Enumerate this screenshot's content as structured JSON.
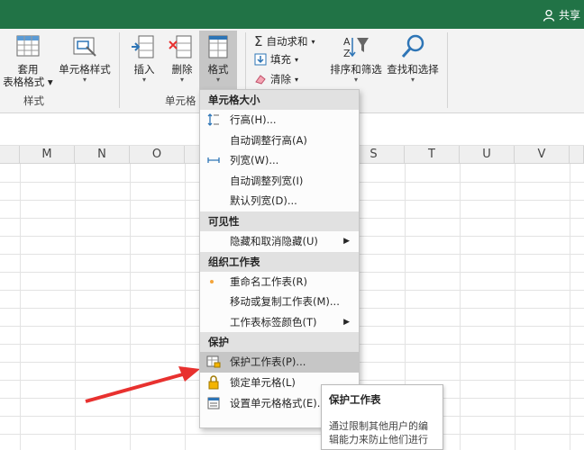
{
  "titlebar": {
    "share_label": "共享"
  },
  "ribbon": {
    "styles_group": {
      "label": "样式",
      "table_format_top": "套用",
      "table_format_bottom": "表格格式",
      "cell_styles": "单元格样式"
    },
    "cells_group": {
      "label": "单元格",
      "insert": "插入",
      "delete": "删除",
      "format": "格式"
    },
    "editing_group": {
      "autosum": "自动求和",
      "fill": "填充",
      "clear": "清除",
      "sort_filter": "排序和筛选",
      "find_select": "查找和选择"
    }
  },
  "columns": [
    "M",
    "N",
    "O",
    "S",
    "T",
    "U",
    "V"
  ],
  "menu": {
    "sections": [
      {
        "title": "单元格大小",
        "items": [
          {
            "label": "行高(H)...",
            "icon": "row-height-icon"
          },
          {
            "label": "自动调整行高(A)",
            "icon": ""
          },
          {
            "label": "列宽(W)...",
            "icon": "column-width-icon"
          },
          {
            "label": "自动调整列宽(I)",
            "icon": ""
          },
          {
            "label": "默认列宽(D)...",
            "icon": ""
          }
        ]
      },
      {
        "title": "可见性",
        "items": [
          {
            "label": "隐藏和取消隐藏(U)",
            "icon": "",
            "submenu": true
          }
        ]
      },
      {
        "title": "组织工作表",
        "items": [
          {
            "label": "重命名工作表(R)",
            "icon": "dot-icon"
          },
          {
            "label": "移动或复制工作表(M)...",
            "icon": ""
          },
          {
            "label": "工作表标签颜色(T)",
            "icon": "",
            "submenu": true
          }
        ]
      },
      {
        "title": "保护",
        "items": [
          {
            "label": "保护工作表(P)...",
            "icon": "protect-sheet-icon",
            "highlighted": true
          },
          {
            "label": "锁定单元格(L)",
            "icon": "lock-icon"
          },
          {
            "label": "设置单元格格式(E)...",
            "icon": "format-cells-icon"
          }
        ]
      }
    ]
  },
  "tooltip": {
    "title": "保护工作表",
    "desc": "通过限制其他用户的编辑能力来防止他们进行"
  },
  "colors": {
    "titlebar": "#217346",
    "arrow": "#e8312f",
    "highlight": "#c6c6c6"
  }
}
